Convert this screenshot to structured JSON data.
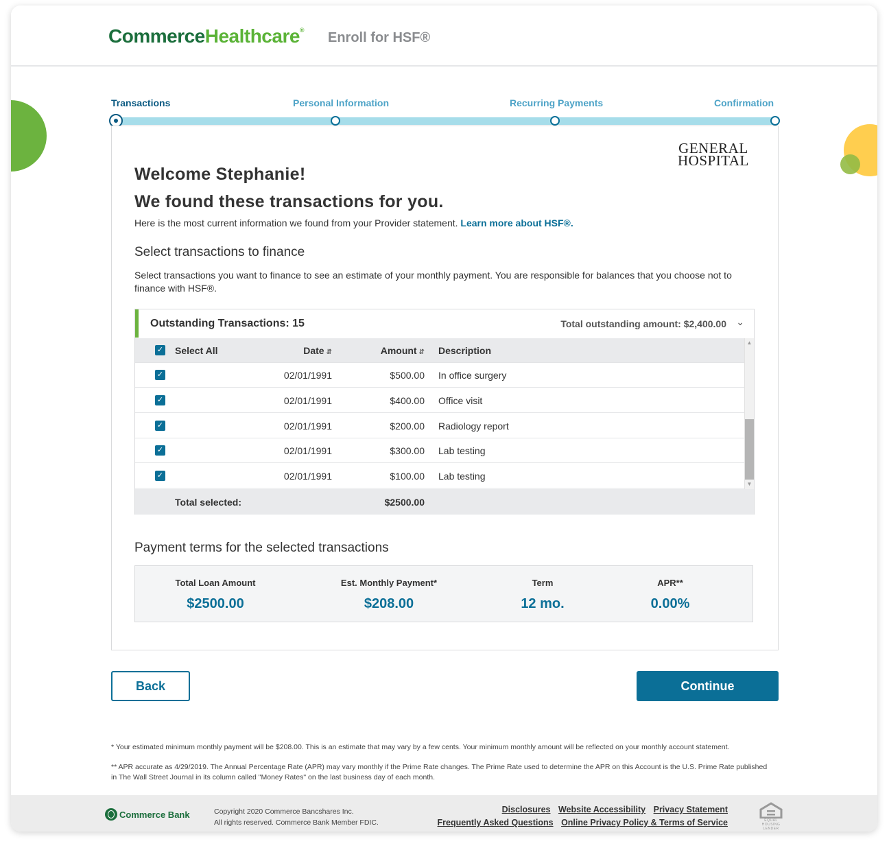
{
  "header": {
    "logo_part1": "Commerce",
    "logo_part2": "Healthcare",
    "logo_mark": "®",
    "app_title": "Enroll for HSF®"
  },
  "stepper": {
    "steps": [
      {
        "label": "Transactions",
        "active": true
      },
      {
        "label": "Personal Information",
        "active": false
      },
      {
        "label": "Recurring Payments",
        "active": false
      },
      {
        "label": "Confirmation",
        "active": false
      }
    ]
  },
  "provider_logo": {
    "line1": "GENERAL",
    "line2": "HOSPITAL"
  },
  "main": {
    "welcome": "Welcome Stephanie!",
    "found": "We found these transactions for you.",
    "intro_text": "Here is the most current information we found from your Provider statement.",
    "learn_more": "Learn more about HSF®.",
    "select_title": "Select transactions to finance",
    "select_help": "Select transactions you want to finance to see an estimate of your monthly payment. You are responsible for balances that you choose not to finance with HSF®."
  },
  "transactions": {
    "outstanding_label": "Outstanding Transactions: 15",
    "total_outstanding": "Total outstanding amount: $2,400.00",
    "columns": {
      "select_all": "Select All",
      "date": "Date",
      "amount": "Amount",
      "description": "Description"
    },
    "rows": [
      {
        "date": "02/01/1991",
        "amount": "$500.00",
        "description": "In office surgery",
        "checked": true
      },
      {
        "date": "02/01/1991",
        "amount": "$400.00",
        "description": "Office visit",
        "checked": true
      },
      {
        "date": "02/01/1991",
        "amount": "$200.00",
        "description": "Radiology report",
        "checked": true
      },
      {
        "date": "02/01/1991",
        "amount": "$300.00",
        "description": "Lab testing",
        "checked": true
      },
      {
        "date": "02/01/1991",
        "amount": "$100.00",
        "description": "Lab testing",
        "checked": true
      }
    ],
    "total_selected_label": "Total selected:",
    "total_selected_value": "$2500.00"
  },
  "payment_terms": {
    "title": "Payment terms for the selected transactions",
    "items": [
      {
        "label": "Total Loan Amount",
        "value": "$2500.00"
      },
      {
        "label": "Est. Monthly Payment*",
        "value": "$208.00"
      },
      {
        "label": "Term",
        "value": "12 mo."
      },
      {
        "label": "APR**",
        "value": "0.00%"
      }
    ]
  },
  "buttons": {
    "back": "Back",
    "continue": "Continue"
  },
  "notes": {
    "note1": "* Your estimated minimum monthly payment will be $208.00. This is an estimate that may vary by a few cents. Your minimum monthly amount will be reflected on your monthly account statement.",
    "note2": "** APR accurate as 4/29/2019. The Annual Percentage Rate (APR) may vary monthly if the Prime Rate changes. The Prime Rate used to determine the APR on this Account is the U.S. Prime Rate published in The Wall Street Journal in its column called \"Money Rates\" on the last business day of each month."
  },
  "footer": {
    "bank_name": "Commerce Bank",
    "copyright_line1": "Copyright 2020 Commerce Bancshares Inc.",
    "copyright_line2": "All rights reserved. Commerce Bank Member FDIC.",
    "links_row1": [
      "Disclosures",
      "Website Accessibility",
      "Privacy Statement"
    ],
    "links_row2": [
      "Frequently Asked Questions",
      "Online Privacy Policy & Terms of Service"
    ],
    "ehl_text": "EQUAL HOUSING LENDER"
  },
  "colors": {
    "primary": "#0b6f97",
    "brand_green": "#6cb33f",
    "brand_dark_green": "#1b6e3c",
    "accent_yellow": "#ffce4f",
    "track": "#a6ddea"
  }
}
